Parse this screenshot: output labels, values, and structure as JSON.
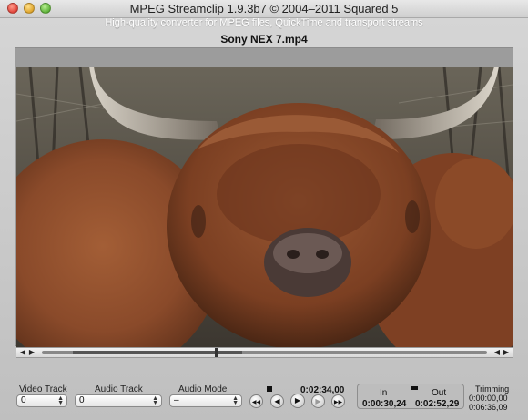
{
  "window": {
    "title": "MPEG Streamclip 1.9.3b7  ©  2004–2011 Squared 5",
    "subtitle": "High-quality converter for MPEG files, QuickTime and transport streams",
    "filename": "Sony NEX 7.mp4"
  },
  "video": {
    "content": "highland cattle close-up"
  },
  "scrub": {
    "left_buttons": [
      "◀",
      "▶"
    ],
    "right_buttons": [
      "◀",
      "▶"
    ],
    "playhead_fraction": 0.39,
    "selection_start_fraction": 0.07,
    "selection_end_fraction": 0.45
  },
  "tracks": {
    "video_track_label": "Video Track",
    "video_track_value": "0",
    "audio_track_label": "Audio Track",
    "audio_track_value": "0",
    "audio_mode_label": "Audio Mode",
    "audio_mode_value": "–"
  },
  "transport": {
    "time": "0:02:34,00",
    "buttons": [
      "◀◀",
      "◀",
      "▶",
      "▶",
      "▶▶"
    ]
  },
  "trim": {
    "in_label": "In",
    "out_label": "Out",
    "in_value": "0:00:30,24",
    "out_value": "0:02:52,29",
    "trimming_label": "Trimming",
    "trimming_start": "0:00:00,00",
    "trimming_duration": "0:06:36,09"
  },
  "colors": {
    "window_bg": "#c9c9c9",
    "fur_brown": "#8a4a2a"
  }
}
